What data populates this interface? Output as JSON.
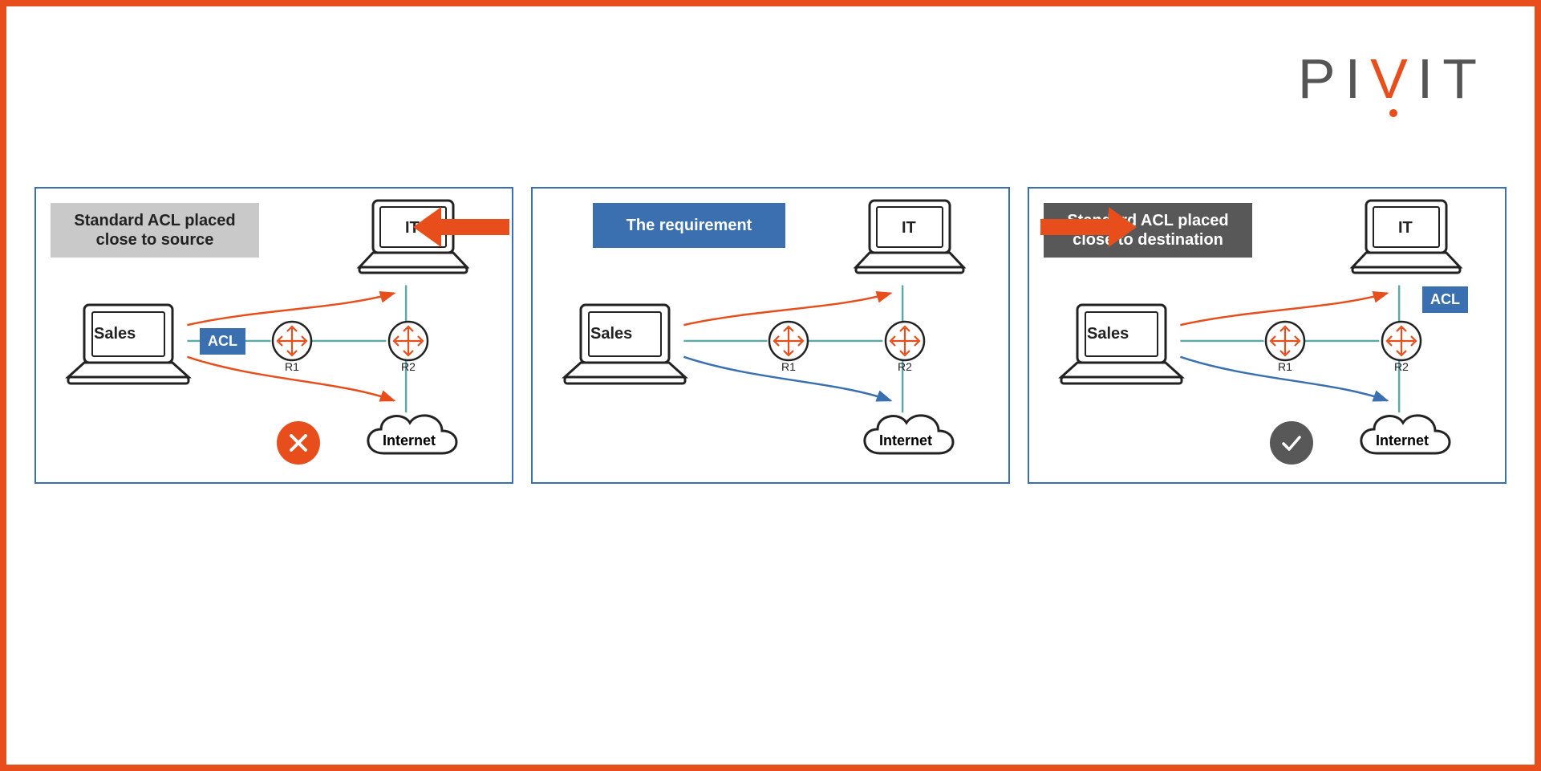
{
  "logo": {
    "p": "P",
    "i1": "I",
    "v": "V",
    "i2": "I",
    "t": "T"
  },
  "panels": {
    "left": {
      "title": "Standard ACL placed\nclose to source",
      "sales": "Sales",
      "it": "IT",
      "r1": "R1",
      "r2": "R2",
      "acl": "ACL",
      "internet": "Internet"
    },
    "center": {
      "title": "The requirement",
      "sales": "Sales",
      "it": "IT",
      "r1": "R1",
      "r2": "R2",
      "internet": "Internet"
    },
    "right": {
      "title": "Standard ACL placed\nclose to destination",
      "sales": "Sales",
      "it": "IT",
      "r1": "R1",
      "r2": "R2",
      "acl": "ACL",
      "internet": "Internet"
    }
  },
  "colors": {
    "orange": "#E84E1B",
    "blue": "#3A6FB0",
    "grey": "#C9C9C9",
    "dark": "#585858",
    "teal": "#5FA8A8"
  }
}
